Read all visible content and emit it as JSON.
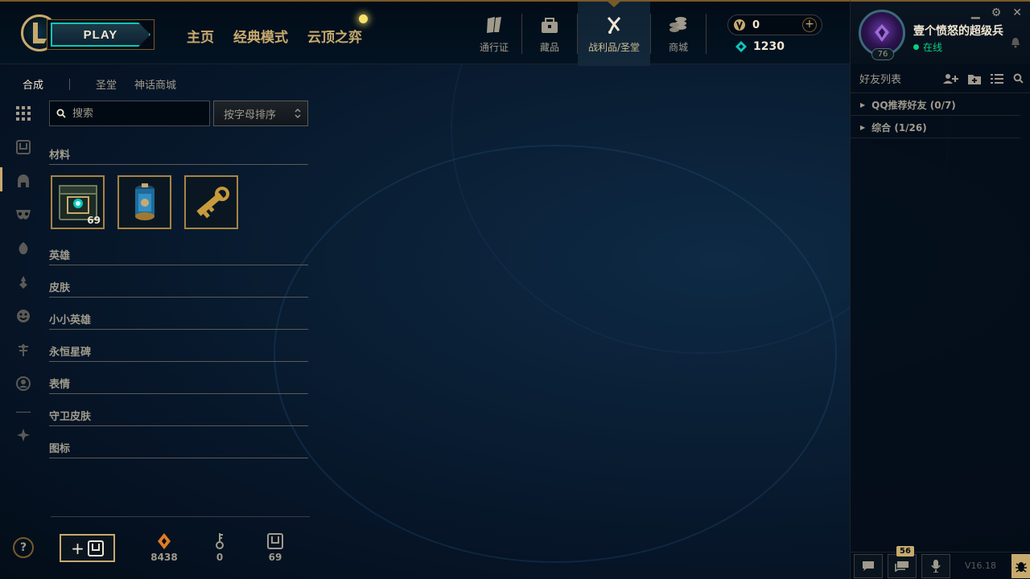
{
  "topbar": {
    "play_label": "PLAY",
    "nav_main": [
      "主页",
      "经典模式",
      "云顶之弈"
    ],
    "nav_icons": [
      {
        "label": "通行证",
        "icon": "pass-icon"
      },
      {
        "label": "藏品",
        "icon": "collection-icon"
      },
      {
        "label": "战利品/圣堂",
        "icon": "loot-icon",
        "active": true
      },
      {
        "label": "商城",
        "icon": "store-icon"
      }
    ],
    "rp": "0",
    "blue_essence": "1230"
  },
  "profile": {
    "name": "壹个愤怒的超级兵",
    "level": "76",
    "status": "在线"
  },
  "window_controls": {
    "minimize": "▁",
    "settings": "⚙",
    "close": "✕"
  },
  "subtabs": [
    "合成",
    "圣堂",
    "神话商城"
  ],
  "search": {
    "placeholder": "搜索"
  },
  "sort": {
    "label": "按字母排序"
  },
  "categories": {
    "materials": "材料",
    "champions": "英雄",
    "skins": "皮肤",
    "little_legends": "小小英雄",
    "eternals": "永恒星碑",
    "emotes": "表情",
    "ward_skins": "守卫皮肤",
    "icons": "图标"
  },
  "materials": [
    {
      "name": "hextech-chest",
      "count": "69"
    },
    {
      "name": "mystery-capsule",
      "count": ""
    },
    {
      "name": "key-fragment",
      "count": ""
    }
  ],
  "resources": {
    "orange_essence": "8438",
    "keys": "0",
    "chests": "69"
  },
  "friends": {
    "title": "好友列表",
    "groups": [
      "QQ推荐好友 (0/7)",
      "综合 (1/26)"
    ],
    "chat_badge": "56",
    "version": "V16.18"
  },
  "colors": {
    "gold": "#c8aa6e",
    "dark_gold": "#785a28",
    "cyan": "#0ac8b9",
    "online_green": "#0acf83",
    "background": "#0a1f35"
  }
}
